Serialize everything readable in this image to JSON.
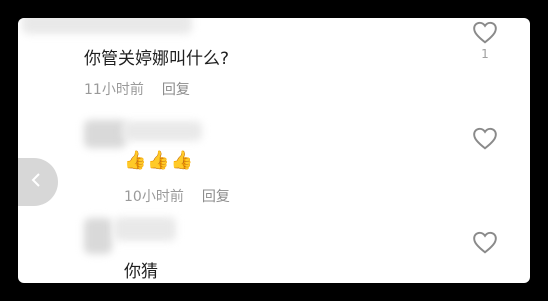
{
  "comments": [
    {
      "text": "你管关婷娜叫什么?",
      "time": "11小时前",
      "reply_label": "回复",
      "like_count": "1"
    },
    {
      "text": "👍👍👍",
      "time": "10小时前",
      "reply_label": "回复",
      "like_count": ""
    },
    {
      "text": "你猜",
      "time": "",
      "reply_label": "",
      "like_count": ""
    }
  ],
  "icons": {
    "like": "heart-outline-icon",
    "side_nav": "chevron-left-icon"
  },
  "colors": {
    "text": "#1f1f1f",
    "meta": "#9a9a9a",
    "heart": "#8a8a8a",
    "thumbs": "#f0a400"
  }
}
